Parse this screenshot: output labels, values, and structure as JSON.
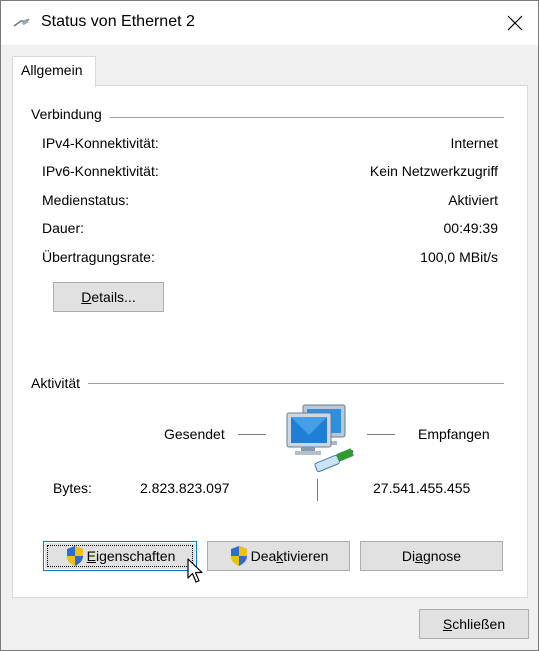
{
  "window": {
    "title": "Status von Ethernet 2",
    "close_icon": "close-icon"
  },
  "tabs": [
    {
      "label": "Allgemein",
      "active": true
    }
  ],
  "connection": {
    "title": "Verbindung",
    "rows": [
      {
        "label": "IPv4-Konnektivität:",
        "value": "Internet"
      },
      {
        "label": "IPv6-Konnektivität:",
        "value": "Kein Netzwerkzugriff"
      },
      {
        "label": "Medienstatus:",
        "value": "Aktiviert"
      },
      {
        "label": "Dauer:",
        "value": "00:49:39"
      },
      {
        "label": "Übertragungsrate:",
        "value": "100,0 MBit/s"
      }
    ],
    "details_button": {
      "prefix": "",
      "accel": "D",
      "rest": "etails..."
    }
  },
  "activity": {
    "title": "Aktivität",
    "sent_label": "Gesendet",
    "received_label": "Empfangen",
    "bytes_label": "Bytes:",
    "bytes_sent": "2.823.823.097",
    "bytes_received": "27.541.455.455",
    "icon": "network-computers-icon"
  },
  "buttons": {
    "properties": {
      "accel": "E",
      "rest": "igenschaften",
      "icon": "uac-shield-icon"
    },
    "deactivate": {
      "prefix": "Dea",
      "accel": "k",
      "rest": "tivieren",
      "icon": "uac-shield-icon"
    },
    "diagnose": {
      "prefix": "Di",
      "accel": "a",
      "rest": "gnose"
    },
    "close": {
      "prefix": "",
      "accel": "S",
      "rest": "chließen"
    }
  }
}
